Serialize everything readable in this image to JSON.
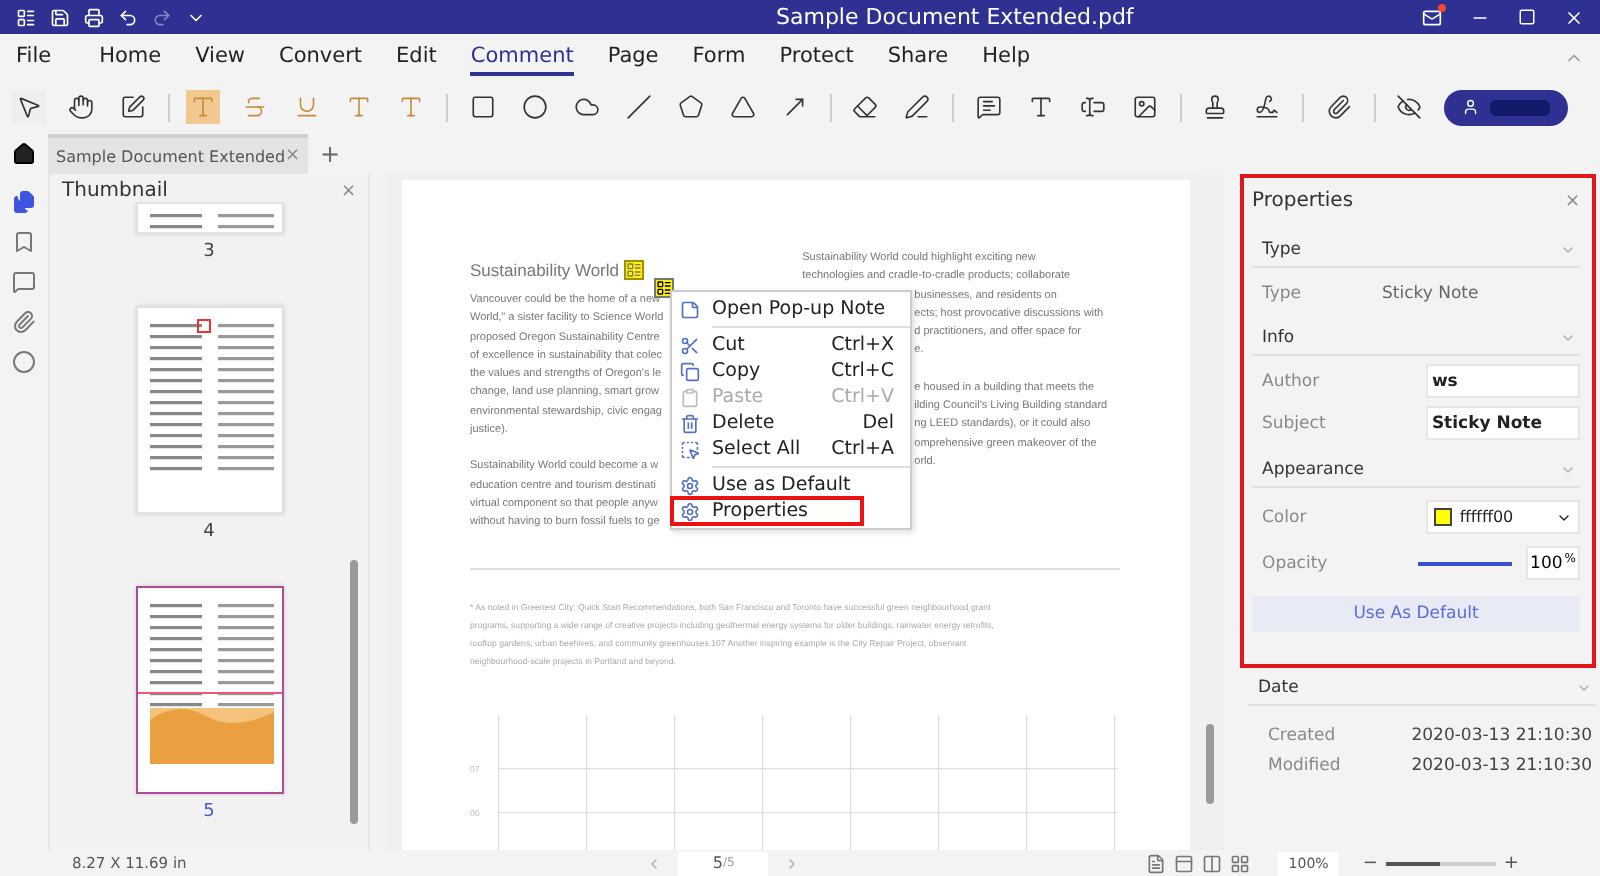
{
  "window": {
    "title": "Sample Document Extended.pdf"
  },
  "menu": [
    {
      "label": "File",
      "selected": false
    },
    {
      "label": "Home",
      "selected": false
    },
    {
      "label": "View",
      "selected": false
    },
    {
      "label": "Convert",
      "selected": false
    },
    {
      "label": "Edit",
      "selected": false
    },
    {
      "label": "Comment",
      "selected": true
    },
    {
      "label": "Page",
      "selected": false
    },
    {
      "label": "Form",
      "selected": false
    },
    {
      "label": "Protect",
      "selected": false
    },
    {
      "label": "Share",
      "selected": false
    },
    {
      "label": "Help",
      "selected": false
    }
  ],
  "tabs": [
    {
      "label": "Sample Document Extended",
      "selected": true,
      "close": "×"
    }
  ],
  "new_tab": "+",
  "thumbnail_panel": {
    "title": "Thumbnail",
    "close": "×",
    "pages": [
      {
        "label": "3",
        "selected": false,
        "kind": "cut"
      },
      {
        "label": "4",
        "selected": false,
        "kind": "full"
      },
      {
        "label": "5",
        "selected": true,
        "kind": "full"
      }
    ]
  },
  "document": {
    "heading": "Sustainability World",
    "left_column": [
      [
        "Vancouver could be the home of a new",
        "World,” a sister facility to Science World",
        "proposed Oregon Sustainability Centre",
        "of excellence in sustainability that colec",
        "the values and strengths of Oregon's le",
        "change, land use planning, smart grow",
        "environmental stewardship, civic engag",
        "justice)."
      ],
      [
        "Sustainability World could become a w",
        "education centre and tourism destinati",
        "virtual component so that people anyw",
        "without having to burn fossil fuels to ge"
      ]
    ],
    "right_column_top": [
      "Sustainability World could highlight exciting new",
      "technologies and cradle-to-cradle products; collaborate"
    ],
    "right_column_beside_menu": [
      [
        "businesses, and residents on",
        "ects; host provocative discussions with",
        "d practitioners, and offer space for",
        "e."
      ],
      [
        "e housed in a building that meets the",
        "ilding Council's Living Building standard",
        "ng LEED standards), or it could also",
        "omprehensive green makeover of the",
        "orld."
      ]
    ],
    "footnote": [
      "* As noted in Greenest City: Quick Start Recommendations, both San Francisco and Toronto have successful green neighbourhood grant",
      "programs, supporting a wide range of creative projects including geothermal energy systems for older buildings, rainwater energy retrofits,",
      "rooftop gardens, urban beehives, and community greenhouses.107 Another inspiring example is the City Repair Project, observant",
      "neighbourhood-scale projects in Portland and beyond."
    ],
    "chart_labels": [
      "07",
      "06"
    ]
  },
  "context_menu": {
    "items": [
      {
        "label": "Open Pop-up Note",
        "disabled": false,
        "highlighted": false,
        "kind": "note"
      },
      {
        "label": "Cut",
        "shortcut": "Ctrl+X",
        "disabled": false,
        "highlighted": false,
        "kind": "cut"
      },
      {
        "label": "Copy",
        "shortcut": "Ctrl+C",
        "disabled": false,
        "highlighted": false,
        "kind": "copy"
      },
      {
        "label": "Paste",
        "shortcut": "Ctrl+V",
        "disabled": true,
        "highlighted": false,
        "kind": "paste"
      },
      {
        "label": "Delete",
        "shortcut": "Del",
        "disabled": false,
        "highlighted": false,
        "kind": "delete"
      },
      {
        "label": "Select All",
        "shortcut": "Ctrl+A",
        "disabled": false,
        "highlighted": false,
        "kind": "selectall"
      },
      {
        "label": "Use as Default",
        "disabled": false,
        "highlighted": false,
        "kind": "gear"
      },
      {
        "label": "Properties",
        "disabled": false,
        "highlighted": true,
        "kind": "gear"
      }
    ]
  },
  "properties": {
    "title": "Properties",
    "close": "×",
    "type_section": {
      "title": "Type",
      "label": "Type",
      "value": "Sticky Note"
    },
    "info_section": {
      "title": "Info",
      "author_label": "Author",
      "author": "ws",
      "subject_label": "Subject",
      "subject": "Sticky Note"
    },
    "appearance_section": {
      "title": "Appearance",
      "color_label": "Color",
      "color_value": "ffffff00",
      "color": "#ffff00",
      "opacity_label": "Opacity",
      "opacity": {
        "level": 1,
        "value": "100",
        "unit": "%"
      },
      "default_button": "Use As Default"
    },
    "date_section": {
      "title": "Date",
      "created_label": "Created",
      "created": "2020-03-13 21:10:30",
      "modified_label": "Modified",
      "modified": "2020-03-13 21:10:30"
    }
  },
  "status_bar": {
    "page_size": "8.27 X 11.69 in",
    "page": "5",
    "page_total": "/5",
    "zoom": "100%",
    "zoom_slider": {
      "level": 0.5
    },
    "zoom_minus": "−",
    "zoom_plus": "+"
  }
}
